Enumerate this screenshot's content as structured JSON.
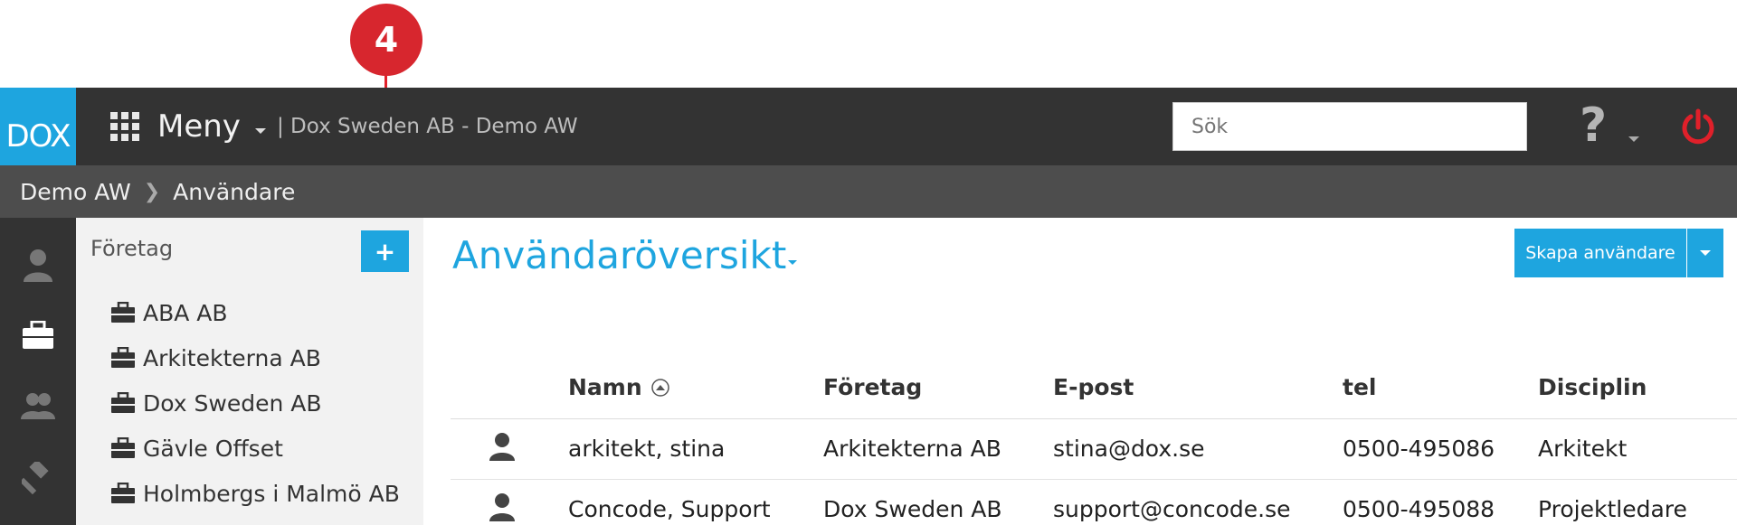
{
  "callout": {
    "number": "4"
  },
  "topbar": {
    "logo": "DOX",
    "menu_label": "Meny",
    "context": "| Dox Sweden AB - Demo AW",
    "search_placeholder": "Sök",
    "help_symbol": "?"
  },
  "breadcrumb": {
    "items": [
      "Demo AW",
      "Användare"
    ]
  },
  "sidebar": {
    "title": "Företag",
    "add_label": "+",
    "companies": [
      "ABA AB",
      "Arkitekterna AB",
      "Dox Sweden AB",
      "Gävle Offset",
      "Holmbergs i Malmö AB"
    ]
  },
  "main": {
    "title": "Användaröversikt",
    "create_button": "Skapa användare"
  },
  "table": {
    "headers": [
      "Namn",
      "Företag",
      "E-post",
      "tel",
      "Disciplin"
    ],
    "rows": [
      {
        "name": "arkitekt, stina",
        "company": "Arkitekterna AB",
        "email": "stina@dox.se",
        "tel": "0500-495086",
        "discipline": "Arkitekt"
      },
      {
        "name": "Concode, Support",
        "company": "Dox Sweden AB",
        "email": "support@concode.se",
        "tel": "0500-495088",
        "discipline": "Projektledare"
      }
    ]
  },
  "colors": {
    "accent": "#1ea5df",
    "topbar": "#333333",
    "crumbbar": "#4d4d4d",
    "callout": "#d7262e",
    "power": "#e0202a"
  }
}
